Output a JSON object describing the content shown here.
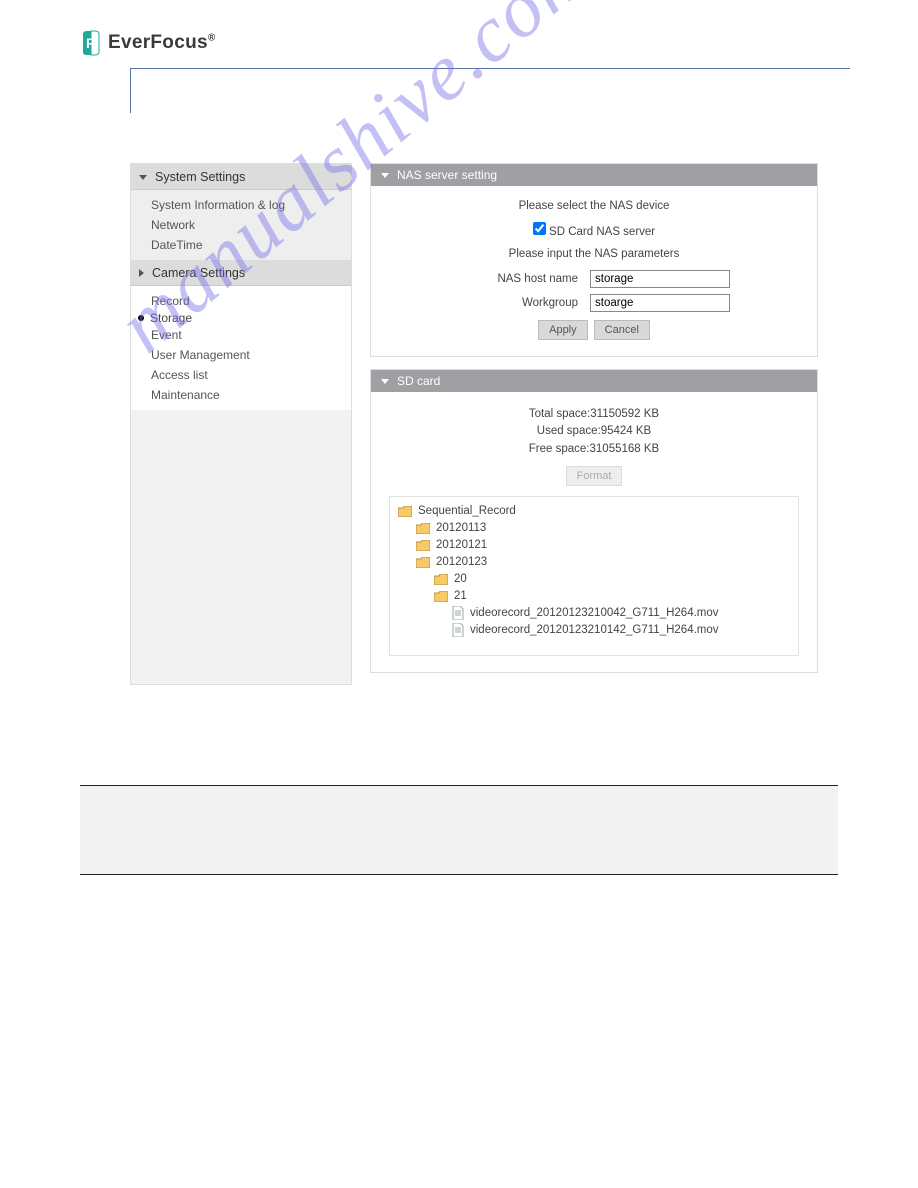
{
  "brand": "EverFocus",
  "brand_reg": "®",
  "watermark": "manualshive.com",
  "sidebar": {
    "system_header": "System Settings",
    "system_items": [
      "System Information & log",
      "Network",
      "DateTime"
    ],
    "camera_header": "Camera Settings",
    "camera_items": [
      "Record",
      "Storage",
      "Event",
      "User Management",
      "Access list",
      "Maintenance"
    ],
    "active": "Storage"
  },
  "nas": {
    "header": "NAS server setting",
    "select_label": "Please select the NAS device",
    "checkbox_label": "SD Card NAS server",
    "checkbox_checked": true,
    "input_label": "Please input the NAS parameters",
    "host_label": "NAS host name",
    "host_value": "storage",
    "workgroup_label": "Workgroup",
    "workgroup_value": "stoarge",
    "apply": "Apply",
    "cancel": "Cancel"
  },
  "sd": {
    "header": "SD card",
    "total_label": "Total space:",
    "total_value": "31150592 KB",
    "used_label": "Used space:",
    "used_value": "95424 KB",
    "free_label": "Free space:",
    "free_value": "31055168 KB",
    "format": "Format",
    "tree": {
      "root": "Sequential_Record",
      "l1": [
        "20120113",
        "20120121",
        "20120123"
      ],
      "l2": [
        "20",
        "21"
      ],
      "files": [
        "videorecord_20120123210042_G711_H264.mov",
        "videorecord_20120123210142_G711_H264.mov"
      ]
    }
  }
}
